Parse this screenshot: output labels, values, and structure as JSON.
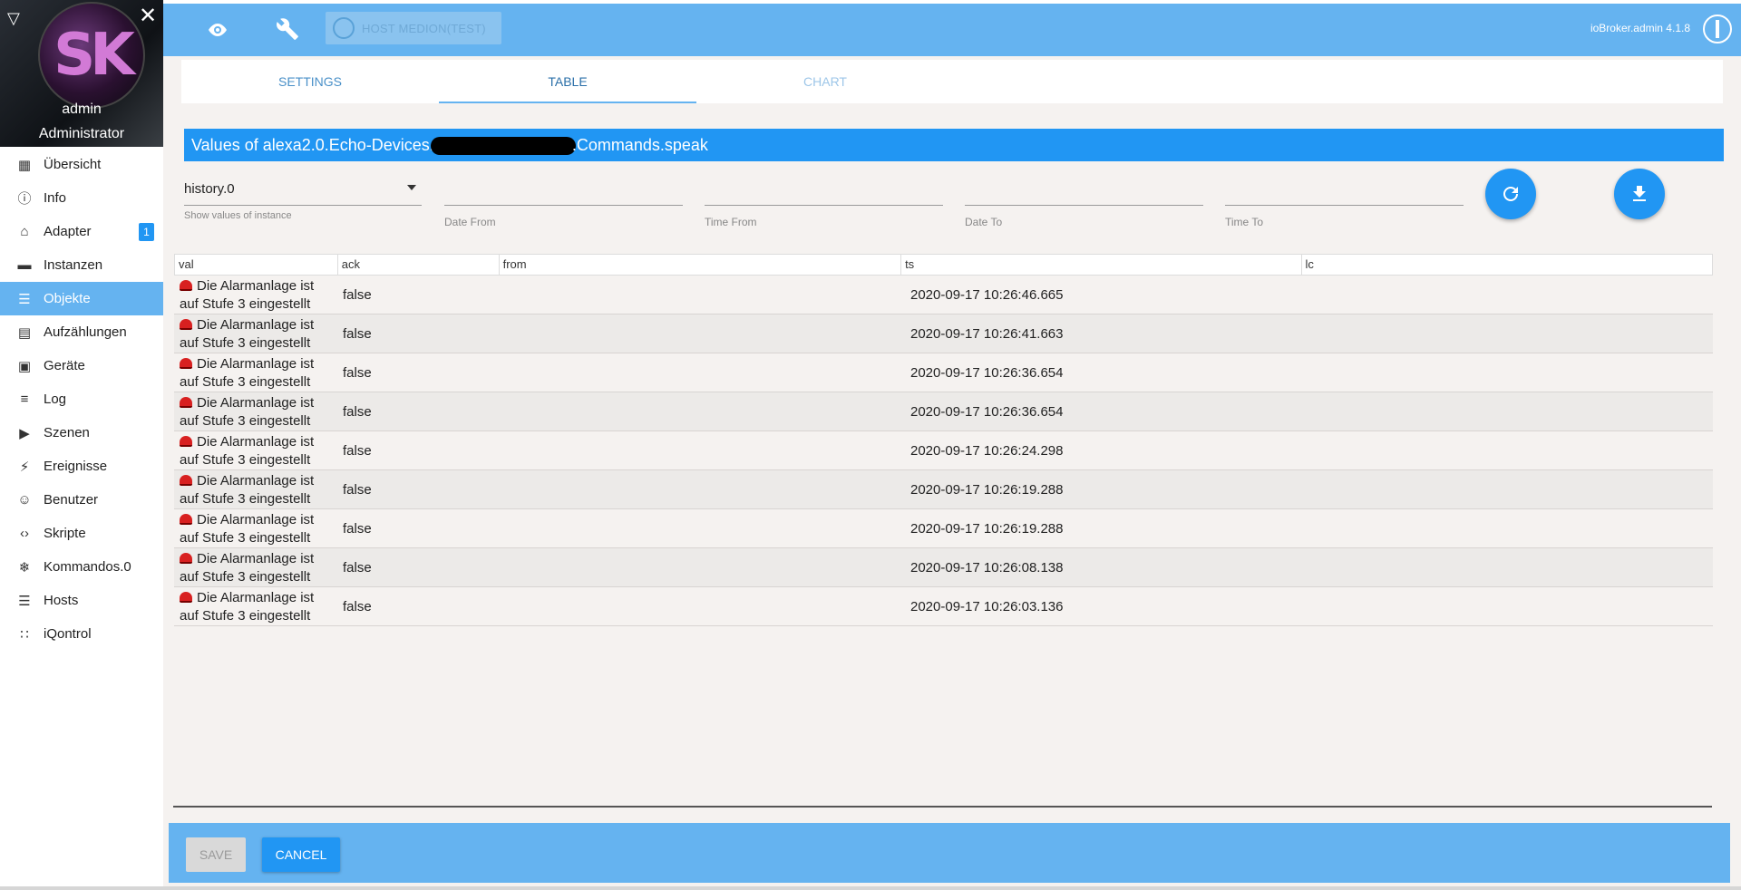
{
  "profile": {
    "avatar_text": "SK",
    "user_name": "admin",
    "user_role": "Administrator"
  },
  "sidebar": {
    "items": [
      {
        "label": "Übersicht",
        "icon": "grid-icon"
      },
      {
        "label": "Info",
        "icon": "info-icon"
      },
      {
        "label": "Adapter",
        "icon": "store-icon",
        "badge": "1"
      },
      {
        "label": "Instanzen",
        "icon": "instances-icon"
      },
      {
        "label": "Objekte",
        "icon": "list-icon",
        "active": true
      },
      {
        "label": "Aufzählungen",
        "icon": "enum-icon"
      },
      {
        "label": "Geräte",
        "icon": "devices-icon"
      },
      {
        "label": "Log",
        "icon": "log-icon"
      },
      {
        "label": "Szenen",
        "icon": "scenes-icon"
      },
      {
        "label": "Ereignisse",
        "icon": "flash-icon"
      },
      {
        "label": "Benutzer",
        "icon": "user-icon"
      },
      {
        "label": "Skripte",
        "icon": "code-icon"
      },
      {
        "label": "Kommandos.0",
        "icon": "snowflake-icon"
      },
      {
        "label": "Hosts",
        "icon": "hosts-icon"
      },
      {
        "label": "iQontrol",
        "icon": "dots-grid-icon"
      }
    ]
  },
  "topbar": {
    "host_label": "HOST MEDION(TEST)",
    "version": "ioBroker.admin 4.1.8"
  },
  "tabs": [
    {
      "label": "SETTINGS",
      "state": "normal"
    },
    {
      "label": "TABLE",
      "state": "selected"
    },
    {
      "label": "CHART",
      "state": "disabled"
    }
  ],
  "values_title": {
    "prefix": "Values of alexa2.0.Echo-Devices.",
    "suffix": ".Commands.speak"
  },
  "filters": {
    "instance_value": "history.0",
    "instance_label": "Show values of instance",
    "date_from": "Date From",
    "time_from": "Time From",
    "date_to": "Date To",
    "time_to": "Time To"
  },
  "table": {
    "columns": [
      "val",
      "ack",
      "from",
      "ts",
      "lc"
    ],
    "rows": [
      {
        "val_line1": "Die Alarmanlage ist",
        "val_line2": "auf Stufe 3 eingestellt",
        "ack": "false",
        "from": "",
        "ts": "2020-09-17 10:26:46.665",
        "lc": ""
      },
      {
        "val_line1": "Die Alarmanlage ist",
        "val_line2": "auf Stufe 3 eingestellt",
        "ack": "false",
        "from": "",
        "ts": "2020-09-17 10:26:41.663",
        "lc": ""
      },
      {
        "val_line1": "Die Alarmanlage ist",
        "val_line2": "auf Stufe 3 eingestellt",
        "ack": "false",
        "from": "",
        "ts": "2020-09-17 10:26:36.654",
        "lc": ""
      },
      {
        "val_line1": "Die Alarmanlage ist",
        "val_line2": "auf Stufe 3 eingestellt",
        "ack": "false",
        "from": "",
        "ts": "2020-09-17 10:26:36.654",
        "lc": ""
      },
      {
        "val_line1": "Die Alarmanlage ist",
        "val_line2": "auf Stufe 3 eingestellt",
        "ack": "false",
        "from": "",
        "ts": "2020-09-17 10:26:24.298",
        "lc": ""
      },
      {
        "val_line1": "Die Alarmanlage ist",
        "val_line2": "auf Stufe 3 eingestellt",
        "ack": "false",
        "from": "",
        "ts": "2020-09-17 10:26:19.288",
        "lc": ""
      },
      {
        "val_line1": "Die Alarmanlage ist",
        "val_line2": "auf Stufe 3 eingestellt",
        "ack": "false",
        "from": "",
        "ts": "2020-09-17 10:26:19.288",
        "lc": ""
      },
      {
        "val_line1": "Die Alarmanlage ist",
        "val_line2": "auf Stufe 3 eingestellt",
        "ack": "false",
        "from": "",
        "ts": "2020-09-17 10:26:08.138",
        "lc": ""
      },
      {
        "val_line1": "Die Alarmanlage ist",
        "val_line2": "auf Stufe 3 eingestellt",
        "ack": "false",
        "from": "",
        "ts": "2020-09-17 10:26:03.136",
        "lc": ""
      }
    ]
  },
  "footer": {
    "save_label": "SAVE",
    "cancel_label": "CANCEL"
  },
  "colors": {
    "primary": "#2196f3",
    "toolbar": "#65b3f0",
    "background": "#f5f2f0"
  }
}
